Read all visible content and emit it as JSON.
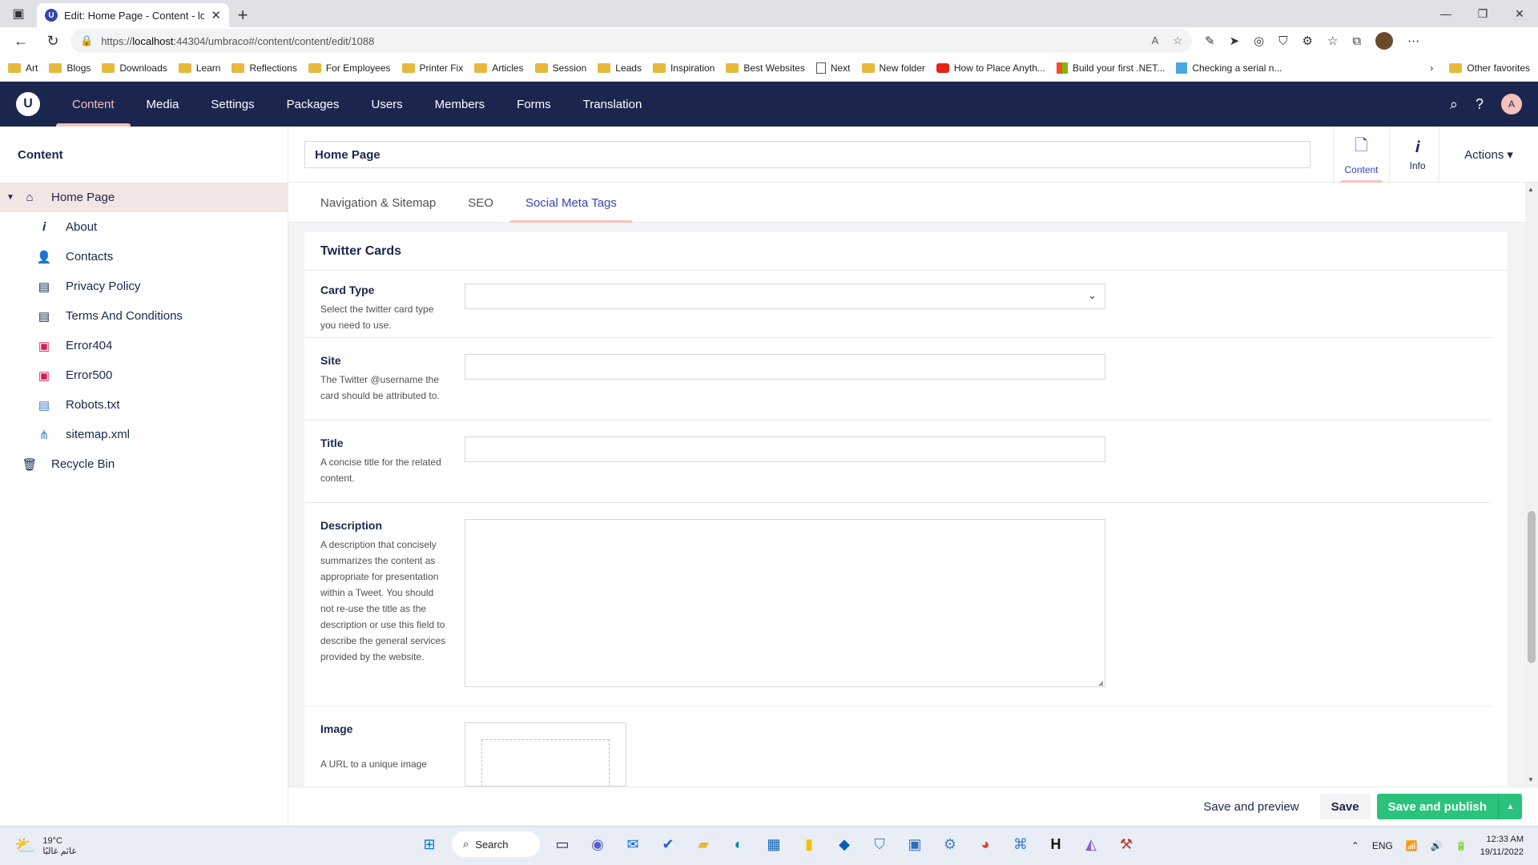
{
  "browser": {
    "tab_title": "Edit: Home Page - Content - loca",
    "url_prefix": "https://",
    "url_host": "localhost",
    "url_rest": ":44304/umbraco#/content/content/edit/1088",
    "favorites": [
      {
        "label": "Art",
        "icon": "folder"
      },
      {
        "label": "Blogs",
        "icon": "folder"
      },
      {
        "label": "Downloads",
        "icon": "folder"
      },
      {
        "label": "Learn",
        "icon": "folder"
      },
      {
        "label": "Reflections",
        "icon": "folder"
      },
      {
        "label": "For Employees",
        "icon": "folder"
      },
      {
        "label": "Printer Fix",
        "icon": "folder"
      },
      {
        "label": "Articles",
        "icon": "folder"
      },
      {
        "label": "Session",
        "icon": "folder"
      },
      {
        "label": "Leads",
        "icon": "folder"
      },
      {
        "label": "Inspiration",
        "icon": "folder"
      },
      {
        "label": "Best Websites",
        "icon": "folder"
      },
      {
        "label": "Next",
        "icon": "page"
      },
      {
        "label": "New folder",
        "icon": "folder"
      },
      {
        "label": "How to Place Anyth...",
        "icon": "youtube"
      },
      {
        "label": "Build your first .NET...",
        "icon": "microsoft"
      },
      {
        "label": "Checking a serial n...",
        "icon": "up"
      }
    ],
    "other_favorites": "Other favorites"
  },
  "umbraco": {
    "logo": "U",
    "nav": [
      "Content",
      "Media",
      "Settings",
      "Packages",
      "Users",
      "Members",
      "Forms",
      "Translation"
    ],
    "active_nav": "Content",
    "user_initial": "A"
  },
  "sidebar": {
    "title": "Content",
    "root": "Home Page",
    "children": [
      {
        "label": "About",
        "icon": "info-icon",
        "glyph": "𝒊",
        "tone": "dark"
      },
      {
        "label": "Contacts",
        "icon": "contact-icon",
        "glyph": "👤",
        "tone": "dark"
      },
      {
        "label": "Privacy Policy",
        "icon": "document-icon",
        "glyph": "▤",
        "tone": "dark"
      },
      {
        "label": "Terms And Conditions",
        "icon": "document-icon",
        "glyph": "▤",
        "tone": "dark"
      },
      {
        "label": "Error404",
        "icon": "error-icon",
        "glyph": "▣",
        "tone": "red"
      },
      {
        "label": "Error500",
        "icon": "error-icon",
        "glyph": "▣",
        "tone": "red"
      },
      {
        "label": "Robots.txt",
        "icon": "text-file-icon",
        "glyph": "▤",
        "tone": "blue"
      },
      {
        "label": "sitemap.xml",
        "icon": "sitemap-icon",
        "glyph": "⋔",
        "tone": "blue"
      }
    ],
    "recycle_bin": "Recycle Bin"
  },
  "editor": {
    "name": "Home Page",
    "apps": [
      {
        "label": "Content",
        "glyph": "🗋"
      },
      {
        "label": "Info",
        "glyph": "𝒊"
      }
    ],
    "actions": "Actions",
    "tabs": [
      "Navigation & Sitemap",
      "SEO",
      "Social Meta Tags"
    ],
    "active_tab": "Social Meta Tags",
    "group_title": "Twitter Cards",
    "properties": {
      "card_type": {
        "label": "Card Type",
        "desc": "Select the twitter card type you need to use.",
        "value": ""
      },
      "site": {
        "label": "Site",
        "desc": "The Twitter @username the card should be attributed to.",
        "value": ""
      },
      "title": {
        "label": "Title",
        "desc": "A concise title for the related content.",
        "value": ""
      },
      "description": {
        "label": "Description",
        "desc": "A description that concisely summarizes the content as appropriate for presentation within a Tweet. You should not re-use the title as the description or use this field to describe the general services provided by the website.",
        "value": ""
      },
      "image": {
        "label": "Image",
        "desc": "A URL to a unique image"
      }
    }
  },
  "footer": {
    "save_preview": "Save and preview",
    "save": "Save",
    "publish": "Save and publish"
  },
  "taskbar": {
    "temp": "19°C",
    "weather_text": "غائم غالبًا",
    "search": "Search",
    "lang": "ENG",
    "time": "12:33 AM",
    "date": "19/11/2022"
  },
  "colors": {
    "header_bg": "#1b264f",
    "accent_pink": "#f5c1bc",
    "publish_green": "#2bc37c",
    "active_blue": "#3544b1"
  }
}
